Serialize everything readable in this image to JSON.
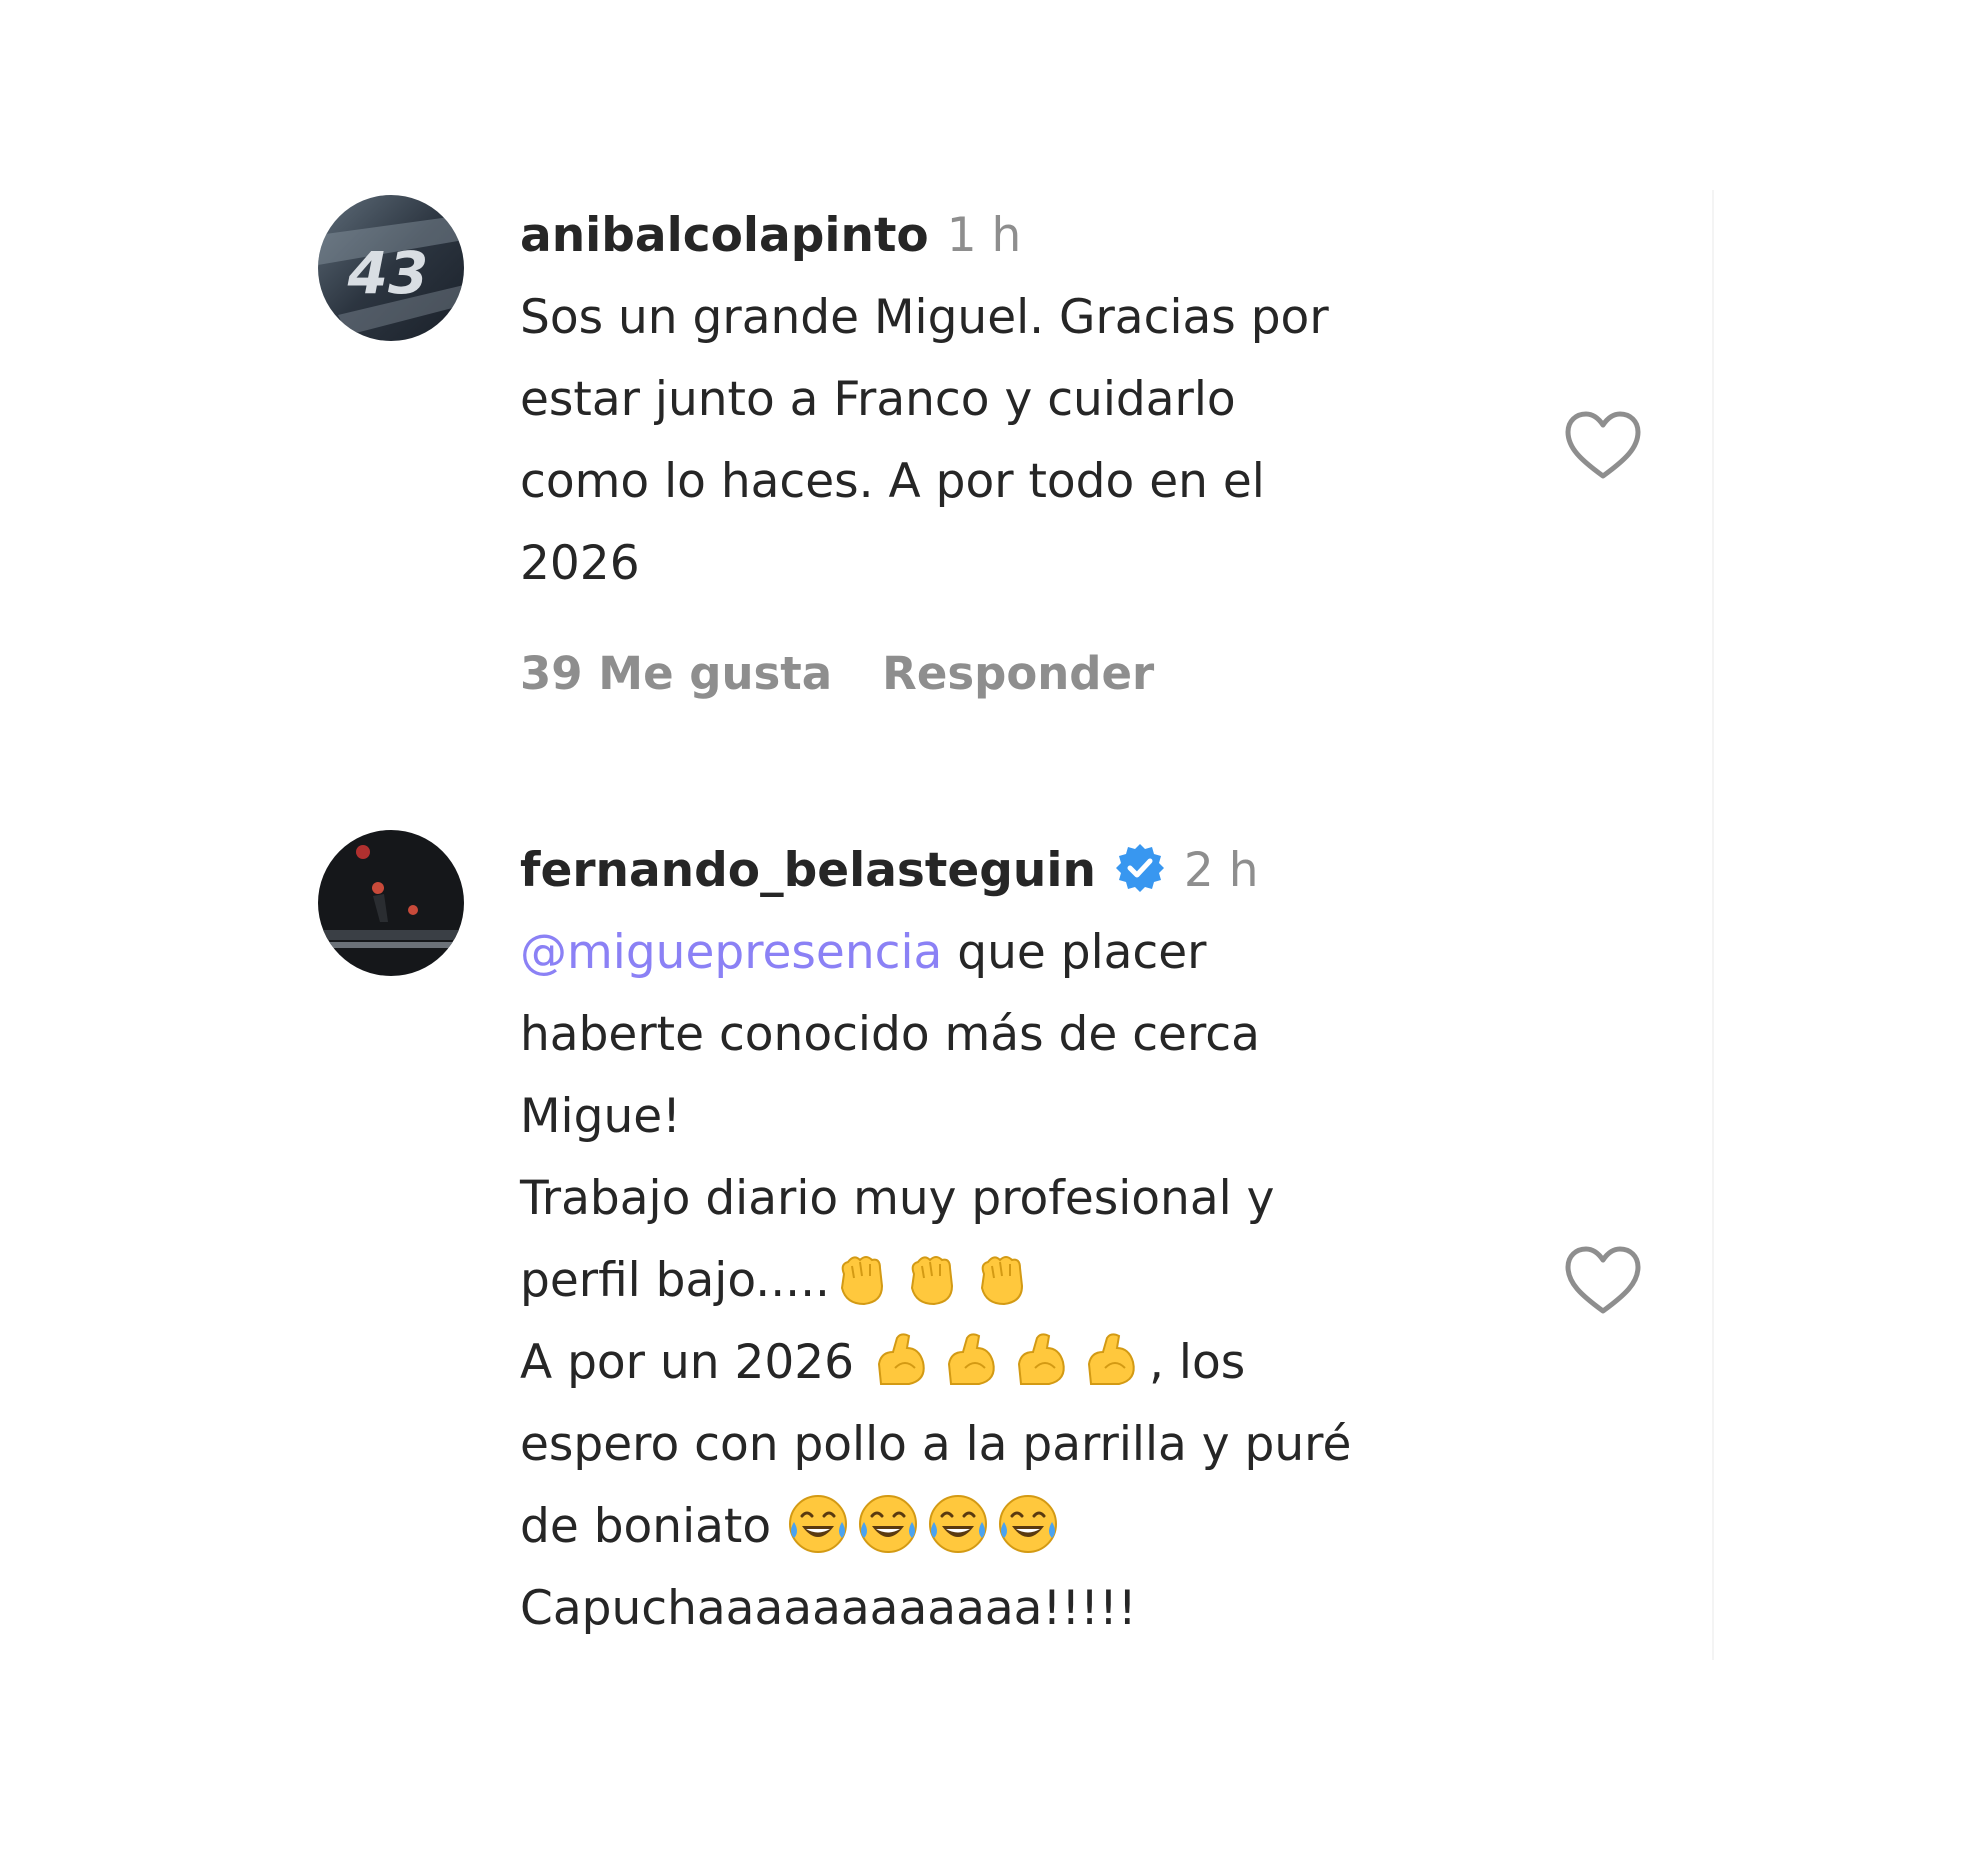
{
  "colors": {
    "username": "#262626",
    "text": "#262626",
    "muted": "#8e8e8e",
    "mention": "#8b81f5",
    "verified": "#3897f0",
    "emoji_yellow": "#ffc83d"
  },
  "comments": [
    {
      "username": "anibalcolapinto",
      "time": "1 h",
      "avatar_icon": "avatar-number-43",
      "avatar_text": "43",
      "verified": false,
      "text": "Sos un grande Miguel. Gracias por\nestar junto a Franco y cuidarlo\ncomo lo haces. A por todo en el\n2026",
      "likes_label": "39 Me gusta",
      "reply_label": "Responder",
      "like_icon": "heart-outline-icon"
    },
    {
      "username": "fernando_belasteguin",
      "time": "2 h",
      "avatar_icon": "avatar-dark-photo",
      "verified": true,
      "verified_icon": "verified-badge-icon",
      "mention": "@miguepresencia",
      "line1": " que placer",
      "line2": "haberte conocido más de cerca",
      "line3": "Migue!",
      "line4": "Trabajo diario muy profesional y",
      "line5": "perfil bajo.....",
      "line6_prefix": "A por un 2026 ",
      "line6_suffix": ", los",
      "line7": "espero con pollo a la parrilla y puré",
      "line8_prefix": "de boniato ",
      "line9": "Capuchaaaaaaaaaaaa!!!!!",
      "emojis": {
        "clap": "clapping-hands-emoji",
        "muscle": "flexed-biceps-emoji",
        "laugh": "tears-of-joy-emoji"
      },
      "like_icon": "heart-outline-icon"
    }
  ]
}
